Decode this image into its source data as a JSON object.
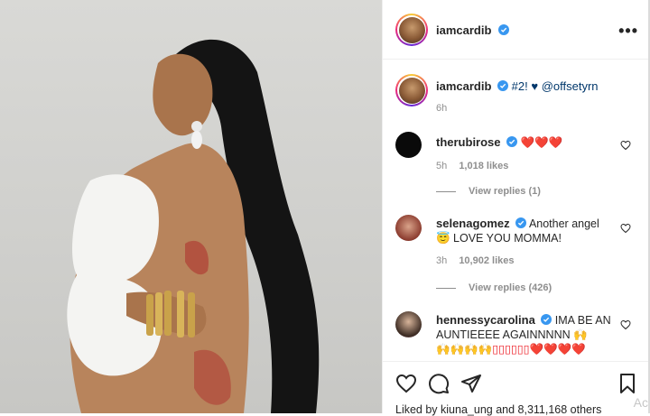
{
  "post": {
    "author": "iamcardib",
    "caption_text": "#2! ♥",
    "caption_mention": "@offsetyrn",
    "time_ago": "6h"
  },
  "comments": [
    {
      "username": "therubirose",
      "text": "❤️❤️❤️",
      "time": "5h",
      "likes": "1,018 likes",
      "replies": "View replies (1)"
    },
    {
      "username": "selenagomez",
      "text": "Another angel",
      "text2": "😇 LOVE YOU MOMMA!",
      "time": "3h",
      "likes": "10,902 likes",
      "replies": "View replies (426)"
    },
    {
      "username": "hennessycarolina",
      "text": "IMA BE AN",
      "text2": "AUNTIEEEE AGAINNNNN 🙌",
      "text3": "🙌🙌🙌🙌▯▯▯▯▯▯❤️❤️❤️❤️"
    }
  ],
  "footer": {
    "liked_by": "Liked by kiuna_ung and 8,311,168 others"
  },
  "edge": "Ac",
  "icons": {
    "more": "more-options-icon",
    "like": "heart-icon",
    "comment": "comment-icon",
    "share": "paper-plane-icon",
    "save": "bookmark-icon"
  },
  "colors": {
    "verified": "#3897f0",
    "heart": "#ed1c24",
    "link": "#00376b",
    "meta": "#8e8e8e"
  }
}
